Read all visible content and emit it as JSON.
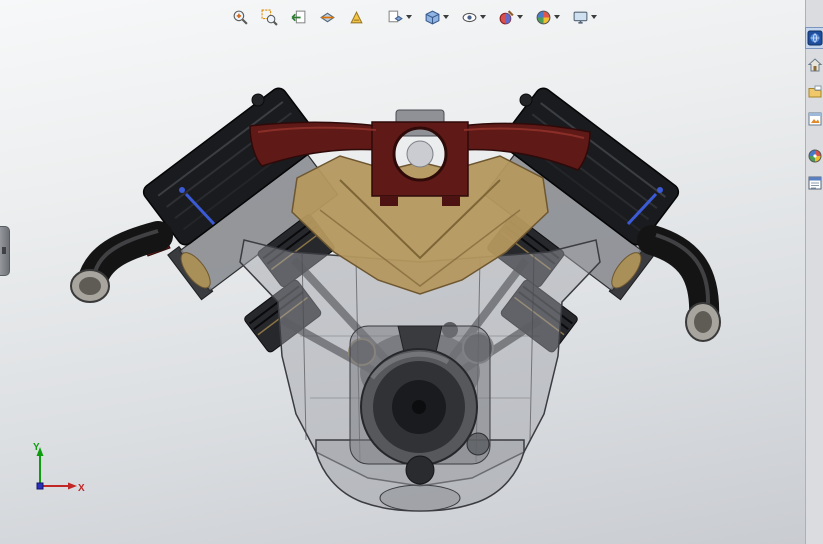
{
  "toolbar": {
    "items": [
      {
        "name": "zoom-to-fit"
      },
      {
        "name": "zoom-to-area"
      },
      {
        "name": "previous-view"
      },
      {
        "name": "section-view"
      },
      {
        "name": "annotation-views"
      },
      {
        "name": "view-orientation"
      },
      {
        "name": "display-style"
      },
      {
        "name": "hide-show-items"
      },
      {
        "name": "edit-appearance"
      },
      {
        "name": "apply-scene"
      },
      {
        "name": "view-settings"
      }
    ]
  },
  "task_pane": {
    "items": [
      {
        "name": "solidworks-resources"
      },
      {
        "name": "design-library"
      },
      {
        "name": "file-explorer"
      },
      {
        "name": "view-palette"
      },
      {
        "name": "appearances-scenes"
      },
      {
        "name": "custom-properties"
      }
    ],
    "active": "solidworks-resources"
  },
  "triad": {
    "x_label": "X",
    "y_label": "Y",
    "x_color": "#c22727",
    "y_color": "#0f9d0f",
    "z_color": "#2a2fb8"
  },
  "viewport": {
    "background_top": "#f7f8f9",
    "background_bottom": "#c9ccd1"
  },
  "model": {
    "name": "v8-engine-assembly",
    "display_style": "shaded-with-edges-transparent",
    "colors": {
      "valve_covers": "#1a1b1e",
      "intake_manifold": "#b5985f",
      "intake_crossover": "#5f1917",
      "engine_block": "#9ea0a6",
      "exhaust": "#161616",
      "harmonic_balancer": "#2e3034",
      "plug_wires": "#3b5bd6"
    }
  }
}
